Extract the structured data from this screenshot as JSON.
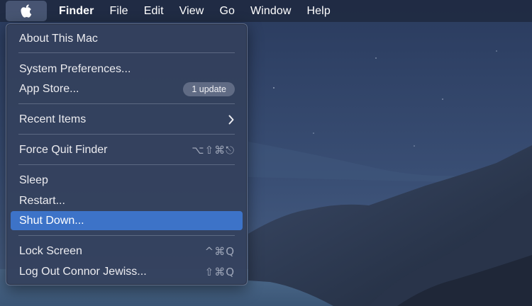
{
  "menubar": {
    "apple_icon": "apple-logo-icon",
    "items": [
      "Finder",
      "File",
      "Edit",
      "View",
      "Go",
      "Window",
      "Help"
    ]
  },
  "apple_menu": {
    "about": "About This Mac",
    "system_preferences": "System Preferences...",
    "app_store": "App Store...",
    "app_store_badge": "1 update",
    "recent_items": "Recent Items",
    "force_quit": "Force Quit Finder",
    "force_quit_shortcut": "⌥⇧⌘⎋",
    "sleep": "Sleep",
    "restart": "Restart...",
    "shut_down": "Shut Down...",
    "lock_screen": "Lock Screen",
    "lock_screen_shortcut": "^⌘Q",
    "log_out": "Log Out Connor Jewiss...",
    "log_out_shortcut": "⇧⌘Q"
  },
  "colors": {
    "highlight": "#3d73c8",
    "menu_bg": "#34415c",
    "menubar_bg": "#202a42"
  }
}
